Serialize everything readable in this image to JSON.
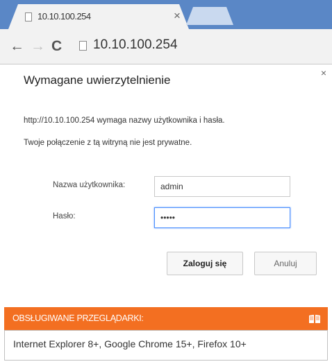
{
  "browser": {
    "tab": {
      "title": "10.10.100.254",
      "close_glyph": "×"
    },
    "nav": {
      "back_glyph": "←",
      "forward_glyph": "→",
      "reload_glyph": "C"
    },
    "address_bar": {
      "url": "10.10.100.254"
    }
  },
  "auth_dialog": {
    "title": "Wymagane uwierzytelnienie",
    "close_glyph": "×",
    "message_line1": "http://10.10.100.254 wymaga nazwy użytkownika i hasła.",
    "message_line2": "Twoje połączenie z tą witryną nie jest prywatne.",
    "username_label": "Nazwa użytkownika:",
    "username_value": "admin",
    "password_label": "Hasło:",
    "password_value": "•••••",
    "login_button": "Zaloguj się",
    "cancel_button": "Anuluj"
  },
  "supported_browsers": {
    "heading": "OBSŁUGIWANE PRZEGLĄDARKI:",
    "icon": "book-icon",
    "list": "Internet Explorer 8+, Google Chrome 15+, Firefox 10+"
  },
  "colors": {
    "tabstrip": "#5a87c6",
    "banner_orange": "#f36f21",
    "focus_blue": "#4d90fe"
  }
}
